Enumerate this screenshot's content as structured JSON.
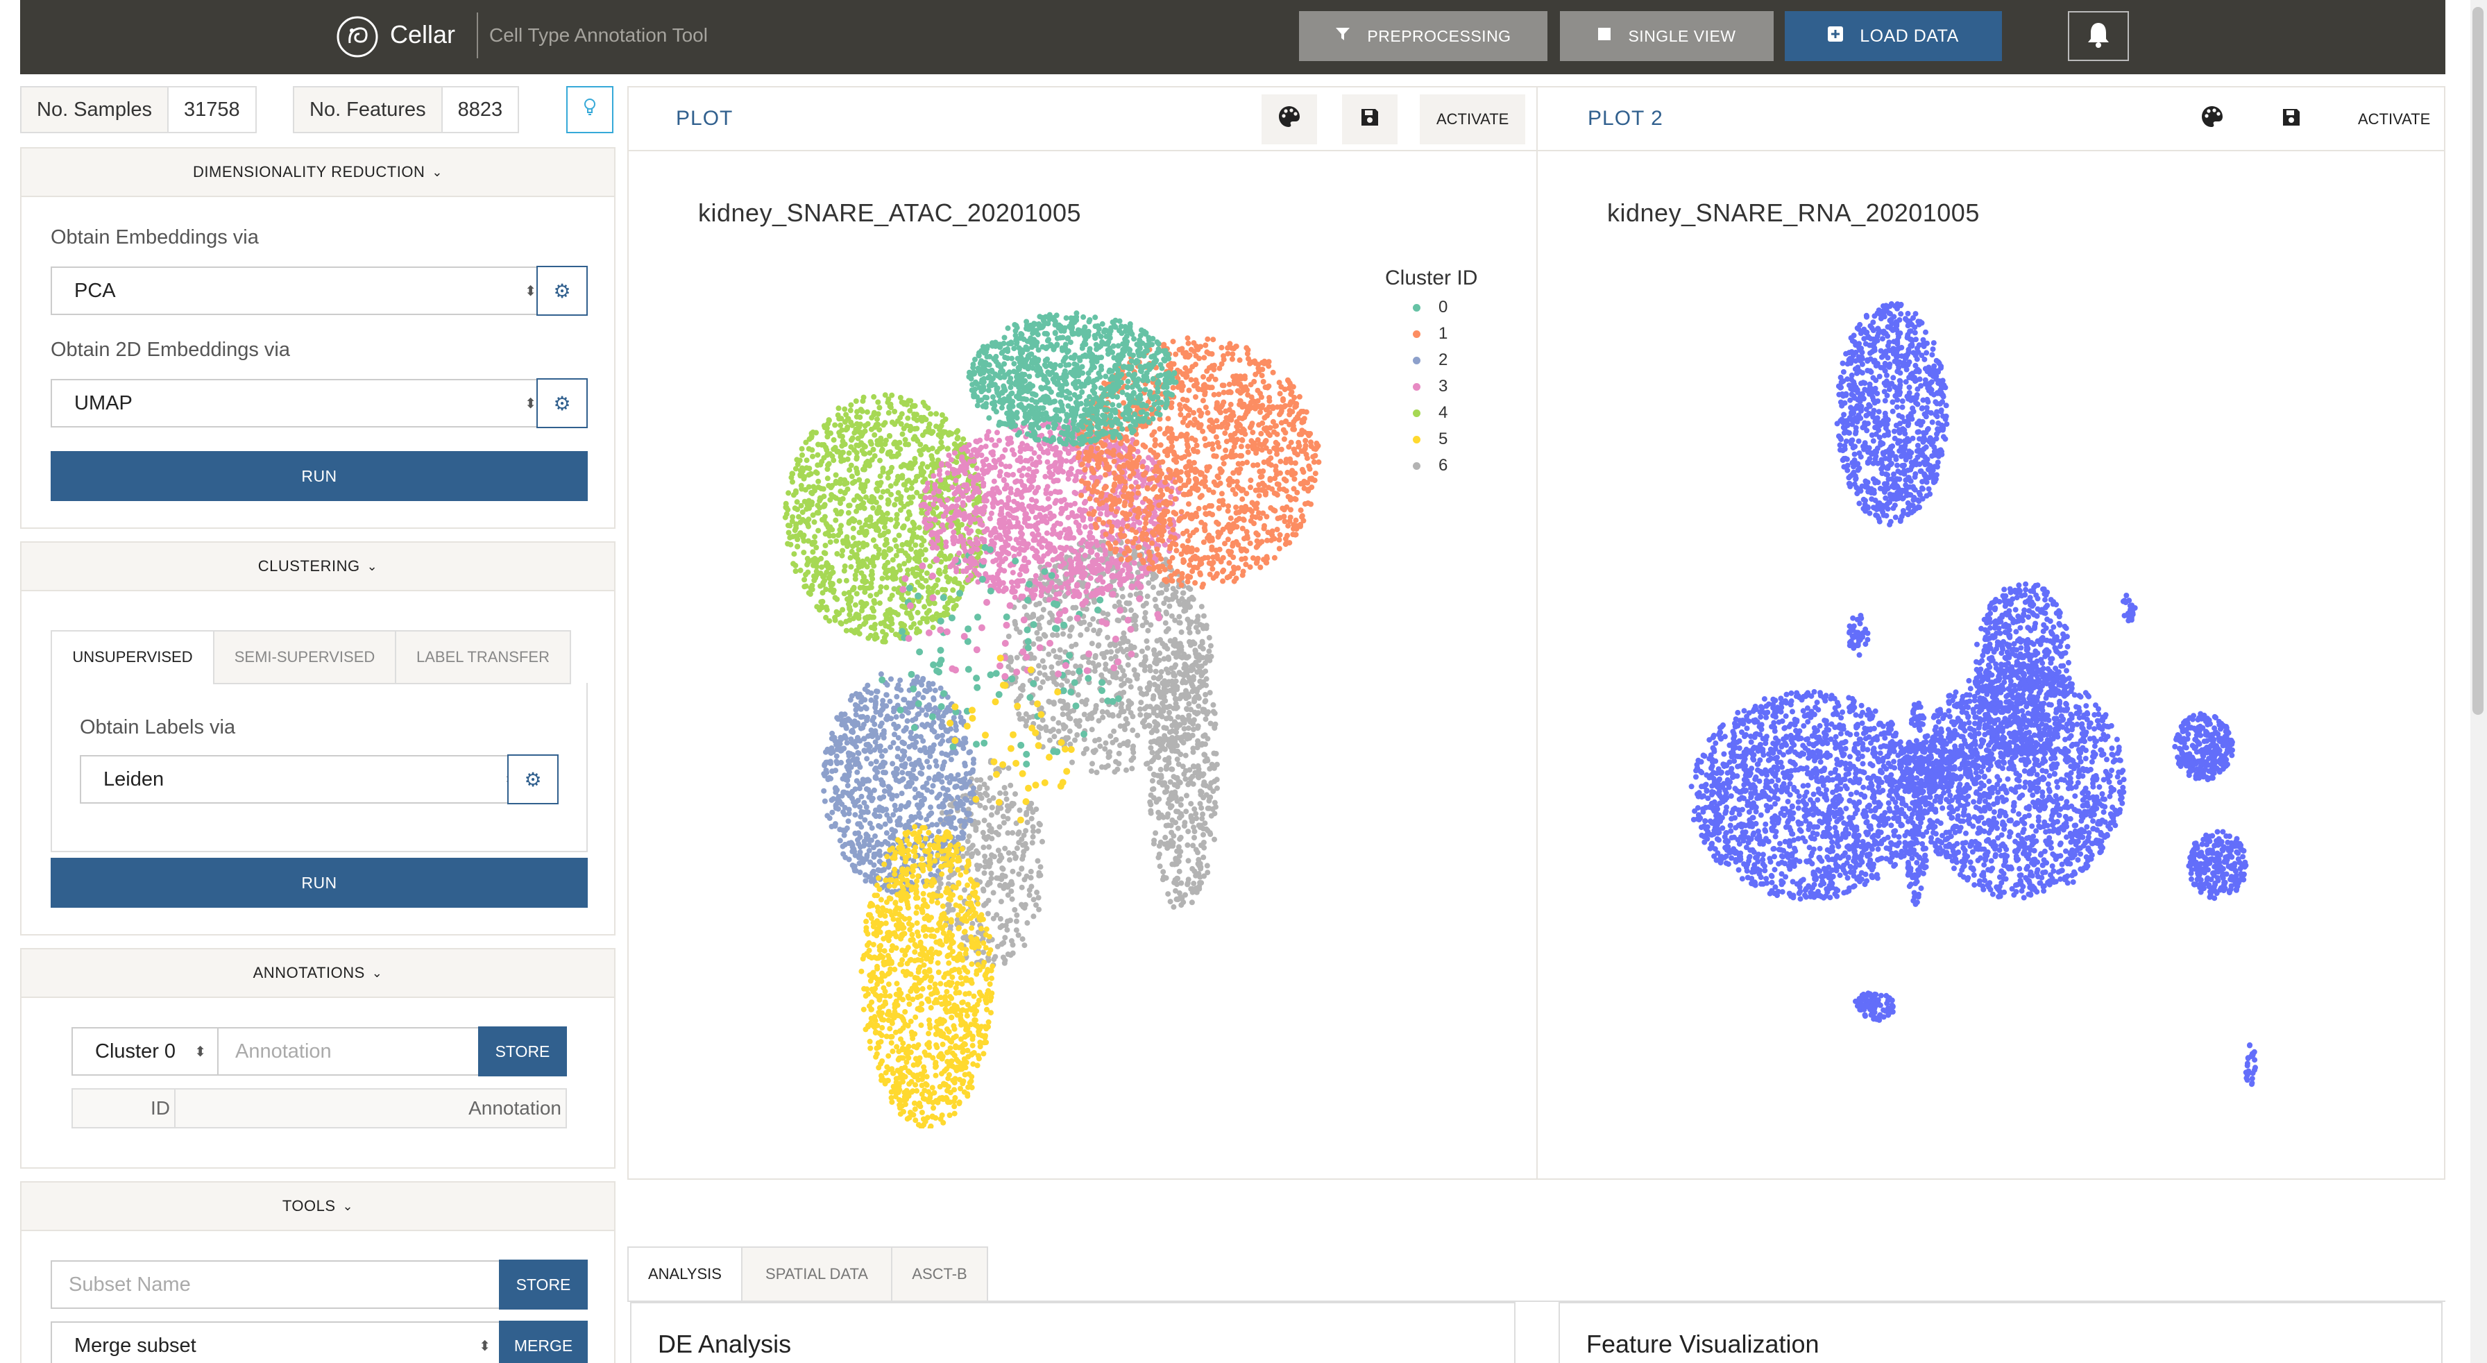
{
  "header": {
    "app_name": "Cellar",
    "tagline": "Cell Type Annotation Tool",
    "preprocessing_label": "PREPROCESSING",
    "single_view_label": "SINGLE VIEW",
    "load_data_label": "LOAD DATA",
    "icons": [
      "cellar-logo-icon",
      "filter-icon",
      "square-icon",
      "plus-square-icon",
      "bell-icon"
    ]
  },
  "counts": {
    "samples_label": "No. Samples",
    "samples_value": "31758",
    "features_label": "No. Features",
    "features_value": "8823"
  },
  "dim_reduction": {
    "title": "DIMENSIONALITY REDUCTION",
    "embeddings_label": "Obtain Embeddings via",
    "embeddings_value": "PCA",
    "embeddings_2d_label": "Obtain 2D Embeddings via",
    "embeddings_2d_value": "UMAP",
    "run_label": "RUN"
  },
  "clustering": {
    "title": "CLUSTERING",
    "tabs": [
      "UNSUPERVISED",
      "SEMI-SUPERVISED",
      "LABEL TRANSFER"
    ],
    "active_tab": "UNSUPERVISED",
    "labels_label": "Obtain Labels via",
    "labels_value": "Leiden",
    "run_label": "RUN"
  },
  "annotations": {
    "title": "ANNOTATIONS",
    "cluster_value": "Cluster 0",
    "annotation_placeholder": "Annotation",
    "store_label": "STORE",
    "table_headers": [
      "ID",
      "Annotation"
    ]
  },
  "tools": {
    "title": "TOOLS",
    "subset_placeholder": "Subset Name",
    "store_label": "STORE",
    "merge_value": "Merge subset",
    "merge_label": "MERGE"
  },
  "plot1": {
    "tab_label": "PLOT",
    "activate_label": "ACTIVATE",
    "dataset_name": "kidney_SNARE_ATAC_20201005",
    "legend_title": "Cluster ID",
    "legend": [
      {
        "label": "0",
        "color": "#66c2a5"
      },
      {
        "label": "1",
        "color": "#fc8d62"
      },
      {
        "label": "2",
        "color": "#8da0cb"
      },
      {
        "label": "3",
        "color": "#e78ac3"
      },
      {
        "label": "4",
        "color": "#a6d854"
      },
      {
        "label": "5",
        "color": "#ffd92f"
      },
      {
        "label": "6",
        "color": "#b3b3b3"
      }
    ]
  },
  "plot2": {
    "tab_label": "PLOT 2",
    "activate_label": "ACTIVATE",
    "dataset_name": "kidney_SNARE_RNA_20201005",
    "point_color": "#636efa"
  },
  "bottom_tabs": [
    "ANALYSIS",
    "SPATIAL DATA",
    "ASCT-B"
  ],
  "bottom_active_tab": "ANALYSIS",
  "de_analysis_title": "DE Analysis",
  "feature_vis_title": "Feature Visualization",
  "colors": {
    "topbar": "#3e3d38",
    "accent": "#31608e",
    "grey_button": "#8f8e8b",
    "info": "#36a9d8"
  }
}
